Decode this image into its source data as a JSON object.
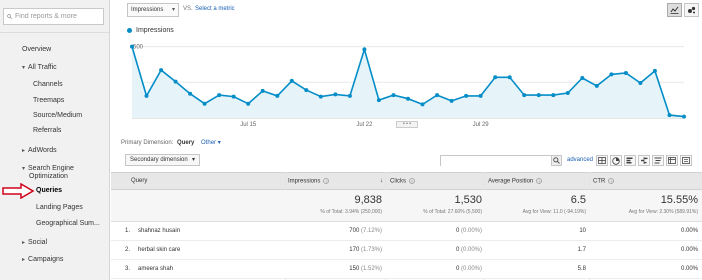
{
  "sidebar": {
    "search_placeholder": "Find reports & more",
    "items": [
      {
        "label": "Overview"
      },
      {
        "label": "All Traffic",
        "arrow": "▾"
      },
      {
        "label": "Channels"
      },
      {
        "label": "Treemaps"
      },
      {
        "label": "Source/Medium"
      },
      {
        "label": "Referrals"
      },
      {
        "label": "AdWords",
        "arrow": "▸"
      },
      {
        "label": "Search Engine",
        "arrow": "▾"
      },
      {
        "label": "Optimization"
      },
      {
        "label": "Queries"
      },
      {
        "label": "Landing Pages"
      },
      {
        "label": "Geographical Sum..."
      },
      {
        "label": "Social",
        "arrow": "▸"
      },
      {
        "label": "Campaigns",
        "arrow": "▸"
      }
    ]
  },
  "toolbar": {
    "metric": "Impressions",
    "vs": "VS.",
    "select_metric": "Select a metric"
  },
  "chart_data": {
    "type": "line",
    "series": [
      {
        "name": "Impressions",
        "values": [
          500,
          155,
          335,
          255,
          170,
          100,
          160,
          150,
          100,
          190,
          155,
          260,
          195,
          150,
          165,
          155,
          480,
          125,
          160,
          135,
          95,
          160,
          120,
          155,
          155,
          285,
          285,
          160,
          160,
          160,
          175,
          280,
          225,
          305,
          315,
          245,
          330,
          20,
          10
        ]
      }
    ],
    "x_tick_labels": [
      "Jul 15",
      "Jul 22",
      "Jul 29"
    ],
    "y_tick_labels": [
      "500",
      "250"
    ],
    "ylim": [
      0,
      560
    ],
    "color": "#058dc7"
  },
  "dimension_bar": {
    "label": "Primary Dimension:",
    "current": "Query",
    "other": "Other ▾"
  },
  "controls": {
    "secondary_dimension": "Secondary dimension",
    "advanced": "advanced"
  },
  "table": {
    "headers": {
      "query": "Query",
      "impressions": "Impressions",
      "clicks": "Clicks",
      "avg_position": "Average Position",
      "ctr": "CTR"
    },
    "totals": {
      "impressions": "9,838",
      "impressions_sub": "% of Total: 3.94% (250,000)",
      "clicks": "1,530",
      "clicks_sub": "% of Total: 27.60% (5,500)",
      "avg_position": "6.5",
      "avg_position_sub": "Avg for View: 11.0 (-94.19%)",
      "ctr": "15.55%",
      "ctr_sub": "Avg for View: 2.30% (589.91%)"
    },
    "rows": [
      {
        "num": "1.",
        "query": "shahnaz husain",
        "impressions": "700",
        "imp_pct": "(7.12%)",
        "clicks": "0",
        "clk_pct": "(0.00%)",
        "avg_position": "10",
        "ctr": "0.00%"
      },
      {
        "num": "2.",
        "query": "herbal skin care",
        "impressions": "170",
        "imp_pct": "(1.73%)",
        "clicks": "0",
        "clk_pct": "(0.00%)",
        "avg_position": "1.7",
        "ctr": "0.00%"
      },
      {
        "num": "3.",
        "query": "ameera shah",
        "impressions": "150",
        "imp_pct": "(1.52%)",
        "clicks": "0",
        "clk_pct": "(0.00%)",
        "avg_position": "5.8",
        "ctr": "0.00%"
      }
    ]
  },
  "colors": {
    "accent": "#058dc7",
    "link": "#1a5fb4",
    "arrow": "#d0021b"
  }
}
